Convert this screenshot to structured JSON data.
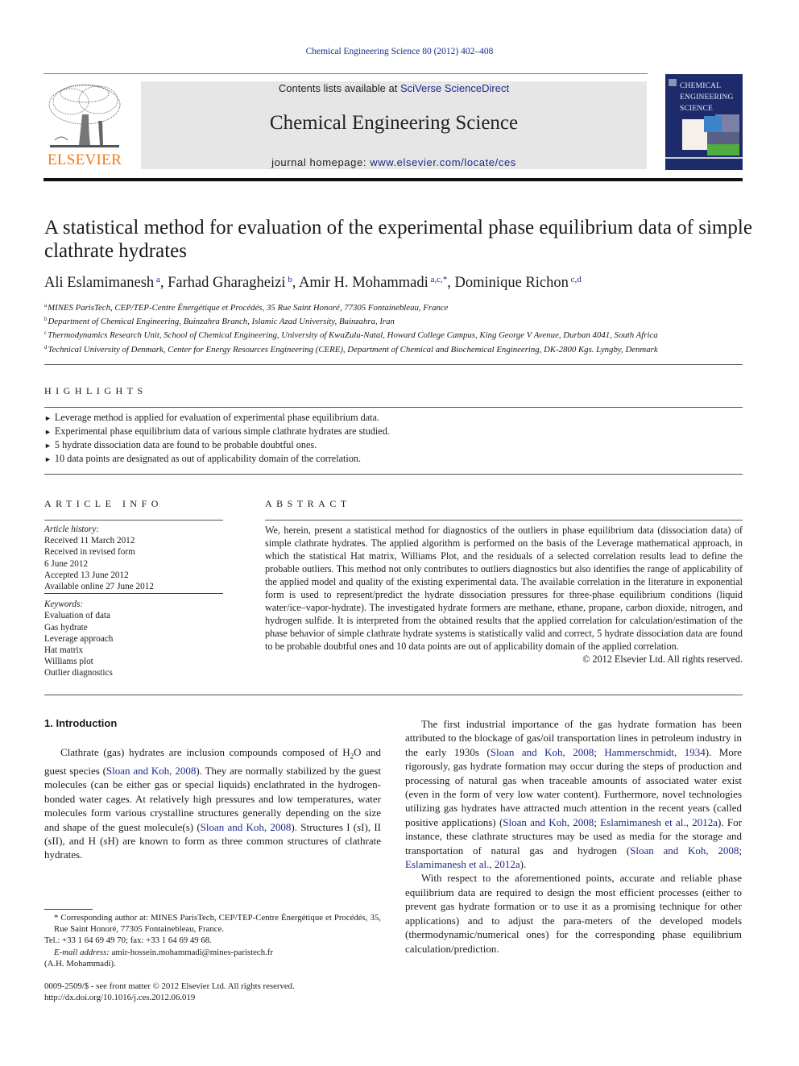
{
  "header": {
    "journal_ref": "Chemical Engineering Science 80 (2012) 402–408",
    "contents_prefix": "Contents lists available at ",
    "contents_link": "SciVerse ScienceDirect",
    "journal_title": "Chemical Engineering Science",
    "homepage_prefix": "journal homepage: ",
    "homepage_link": "www.elsevier.com/locate/ces",
    "publisher_logo_text": "ELSEVIER",
    "cover_title": [
      "CHEMICAL",
      "ENGINEERING",
      "SCIENCE"
    ],
    "colors": {
      "link": "#1c2a8c",
      "elsevier_orange": "#f07b16",
      "cover_blue": "#1d2b6b",
      "header_box": "#e6e6e6"
    }
  },
  "article": {
    "title": "A statistical method for evaluation of the experimental phase equilibrium data of simple clathrate hydrates",
    "authors": [
      {
        "name": "Ali Eslamimanesh",
        "sup": "a"
      },
      {
        "name": "Farhad Gharagheizi",
        "sup": "b"
      },
      {
        "name": "Amir H. Mohammadi",
        "sup": "a,c,*"
      },
      {
        "name": "Dominique Richon",
        "sup": "c,d"
      }
    ],
    "affiliations": [
      {
        "key": "a",
        "text": "MINES ParisTech, CEP/TEP-Centre Énergétique et Procédés, 35 Rue Saint Honoré, 77305 Fontainebleau, France"
      },
      {
        "key": "b",
        "text": "Department of Chemical Engineering, Buinzahra Branch, Islamic Azad University, Buinzahra, Iran"
      },
      {
        "key": "c",
        "text": "Thermodynamics Research Unit, School of Chemical Engineering, University of KwaZulu-Natal, Howard College Campus, King George V Avenue, Durban 4041, South Africa"
      },
      {
        "key": "d",
        "text": "Technical University of Denmark, Center for Energy Resources Engineering (CERE), Department of Chemical and Biochemical Engineering, DK-2800 Kgs. Lyngby, Denmark"
      }
    ]
  },
  "highlights": {
    "heading": "HIGHLIGHTS",
    "bullet": "►",
    "items": [
      "Leverage method is applied for evaluation of experimental phase equilibrium data.",
      "Experimental phase equilibrium data of various simple clathrate hydrates are studied.",
      "5 hydrate dissociation data are found to be probable doubtful ones.",
      "10 data points are designated as out of applicability domain of the correlation."
    ]
  },
  "article_info": {
    "heading": "ARTICLE INFO",
    "history_label": "Article history:",
    "history": [
      "Received 11 March 2012",
      "Received in revised form",
      "6 June 2012",
      "Accepted 13 June 2012",
      "Available online 27 June 2012"
    ],
    "keywords_label": "Keywords:",
    "keywords": [
      "Evaluation of data",
      "Gas hydrate",
      "Leverage approach",
      "Hat matrix",
      "Williams plot",
      "Outlier diagnostics"
    ]
  },
  "abstract": {
    "heading": "ABSTRACT",
    "text": "We, herein, present a statistical method for diagnostics of the outliers in phase equilibrium data (dissociation data) of simple clathrate hydrates. The applied algorithm is performed on the basis of the Leverage mathematical approach, in which the statistical Hat matrix, Williams Plot, and the residuals of a selected correlation results lead to define the probable outliers. This method not only contributes to outliers diagnostics but also identifies the range of applicability of the applied model and quality of the existing experimental data. The available correlation in the literature in exponential form is used to represent/predict the hydrate dissociation pressures for three-phase equilibrium conditions (liquid water/ice–vapor-hydrate). The investigated hydrate formers are methane, ethane, propane, carbon dioxide, nitrogen, and hydrogen sulfide. It is interpreted from the obtained results that the applied correlation for calculation/estimation of the phase behavior of simple clathrate hydrate systems is statistically valid and correct, 5 hydrate dissociation data are found to be probable doubtful ones and 10 data points are out of applicability domain of the applied correlation.",
    "copyright": "© 2012 Elsevier Ltd. All rights reserved."
  },
  "intro": {
    "heading": "1.  Introduction",
    "p1": {
      "t1": "Clathrate (gas) hydrates are inclusion compounds composed of H",
      "sub": "2",
      "t2": "O and guest species (",
      "ref1": "Sloan and Koh, 2008",
      "t3": "). They are normally stabilized by the guest molecules (can be either gas or special liquids) enclathrated in the hydrogen-bonded water cages. At relatively high pressures and low temperatures, water molecules form various crystalline structures generally depending on the size and shape of the guest molecule(s) (",
      "ref2": "Sloan and Koh, 2008",
      "t4": "). Structures I (",
      "s1": "s",
      "t5": "I), II (",
      "s2": "s",
      "t6": "II), and H (",
      "s3": "s",
      "t7": "H) are known to form as three common structures of clathrate hydrates."
    },
    "p2": {
      "t1": "The first industrial importance of the gas hydrate formation has been attributed to the blockage of gas/oil transportation lines in petroleum industry in the early 1930s (",
      "ref1": "Sloan and Koh, 2008",
      "t2": "; ",
      "ref2": "Hammerschmidt, 1934",
      "t3": "). More rigorously, gas hydrate formation may occur during the steps of production and processing of natural gas when traceable amounts of associated water exist (even in the form of very low water content). Furthermore, novel technologies utilizing gas hydrates have attracted much attention in the recent years (called positive applications) (",
      "ref3": "Sloan and Koh, 2008",
      "t4": "; ",
      "ref4": "Eslamimanesh et al., 2012a",
      "t5": "). For instance, these clathrate structures may be used as media for the storage and transportation of natural gas and hydrogen (",
      "ref5": "Sloan and Koh, 2008",
      "t6": "; ",
      "ref6": "Eslamimanesh et al., 2012a",
      "t7": ")."
    },
    "p3": "With respect to the aforementioned points, accurate and reliable phase equilibrium data are required to design the most efficient processes (either to prevent gas hydrate formation or to use it as a promising technique for other applications) and to adjust the para-meters of the developed models (thermodynamic/numerical ones) for the corresponding phase equilibrium calculation/prediction."
  },
  "footnote": {
    "star_line": "* Corresponding author at: MINES ParisTech, CEP/TEP-Centre Énergétique et Procédés, 35, Rue Saint Honoré, 77305 Fontainebleau, France.",
    "tel": "Tel.: +33 1 64 69 49 70; fax: +33 1 64 69 49 68.",
    "email_label": "E-mail address:",
    "email": "amir-hossein.mohammadi@mines-paristech.fr",
    "email_owner": "(A.H. Mohammadi).",
    "issn": "0009-2509/$ - see front matter © 2012 Elsevier Ltd. All rights reserved.",
    "doi": "http://dx.doi.org/10.1016/j.ces.2012.06.019"
  }
}
